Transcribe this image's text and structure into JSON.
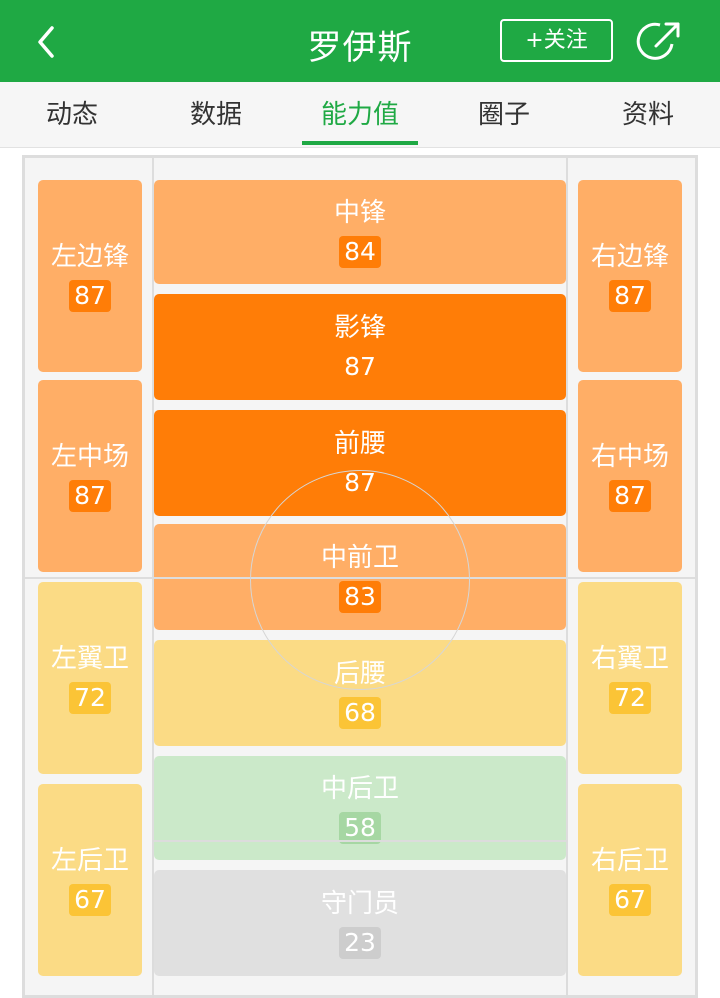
{
  "header": {
    "title": "罗伊斯",
    "follow_label": "+关注",
    "back_icon": "chevron-left-icon",
    "share_icon": "share-icon",
    "color": "#1fa944"
  },
  "tabs": [
    {
      "label": "动态",
      "active": false
    },
    {
      "label": "数据",
      "active": false
    },
    {
      "label": "能力值",
      "active": true
    },
    {
      "label": "圈子",
      "active": false
    },
    {
      "label": "资料",
      "active": false
    }
  ],
  "positions": {
    "lw": {
      "name": "左边锋",
      "value": "87"
    },
    "st": {
      "name": "中锋",
      "value": "84"
    },
    "cf": {
      "name": "影锋",
      "value": "87"
    },
    "rw": {
      "name": "右边锋",
      "value": "87"
    },
    "lm": {
      "name": "左中场",
      "value": "87"
    },
    "cam": {
      "name": "前腰",
      "value": "87"
    },
    "rm": {
      "name": "右中场",
      "value": "87"
    },
    "cm": {
      "name": "中前卫",
      "value": "83"
    },
    "lwb": {
      "name": "左翼卫",
      "value": "72"
    },
    "cdm": {
      "name": "后腰",
      "value": "68"
    },
    "rwb": {
      "name": "右翼卫",
      "value": "72"
    },
    "cb": {
      "name": "中后卫",
      "value": "58"
    },
    "lb": {
      "name": "左后卫",
      "value": "67"
    },
    "gk": {
      "name": "守门员",
      "value": "23"
    },
    "rb": {
      "name": "右后卫",
      "value": "67"
    }
  },
  "colors": {
    "top": "#ff7d07",
    "high": "#ffae66",
    "mid": "#fbdb85",
    "low": "#cbe9c9",
    "gk": "#e0e0e0"
  }
}
